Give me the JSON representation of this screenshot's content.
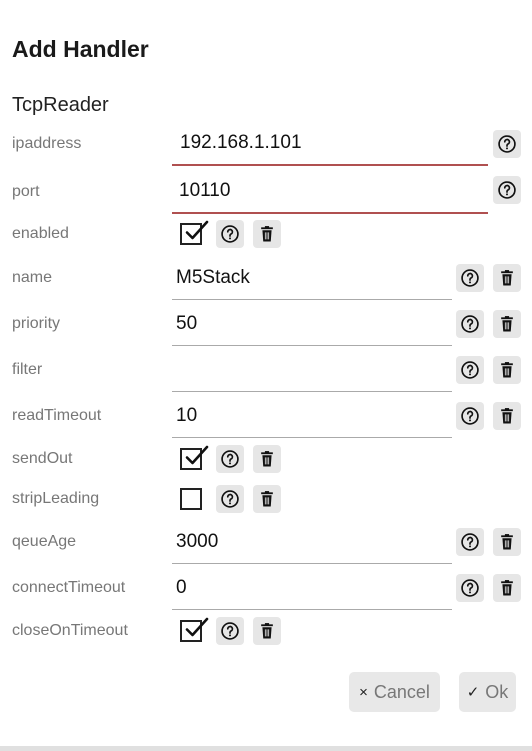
{
  "dialog": {
    "title": "Add Handler",
    "handler_type": "TcpReader"
  },
  "fields": {
    "ipaddress": {
      "label": "ipaddress",
      "value": "192.168.1.101"
    },
    "port": {
      "label": "port",
      "value": "10110"
    },
    "enabled": {
      "label": "enabled",
      "checked": true
    },
    "name": {
      "label": "name",
      "value": "M5Stack"
    },
    "priority": {
      "label": "priority",
      "value": "50"
    },
    "filter": {
      "label": "filter",
      "value": ""
    },
    "readTimeout": {
      "label": "readTimeout",
      "value": "10"
    },
    "sendOut": {
      "label": "sendOut",
      "checked": true
    },
    "stripLeading": {
      "label": "stripLeading",
      "checked": false
    },
    "qeueAge": {
      "label": "qeueAge",
      "value": "3000"
    },
    "connectTimeout": {
      "label": "connectTimeout",
      "value": "0"
    },
    "closeOnTimeout": {
      "label": "closeOnTimeout",
      "checked": true
    }
  },
  "buttons": {
    "cancel_symbol": "×",
    "cancel_label": "Cancel",
    "ok_symbol": "✓",
    "ok_label": "Ok"
  },
  "icons": {
    "help": "help-icon",
    "delete": "trash-icon",
    "checked": "checkmark-icon"
  }
}
